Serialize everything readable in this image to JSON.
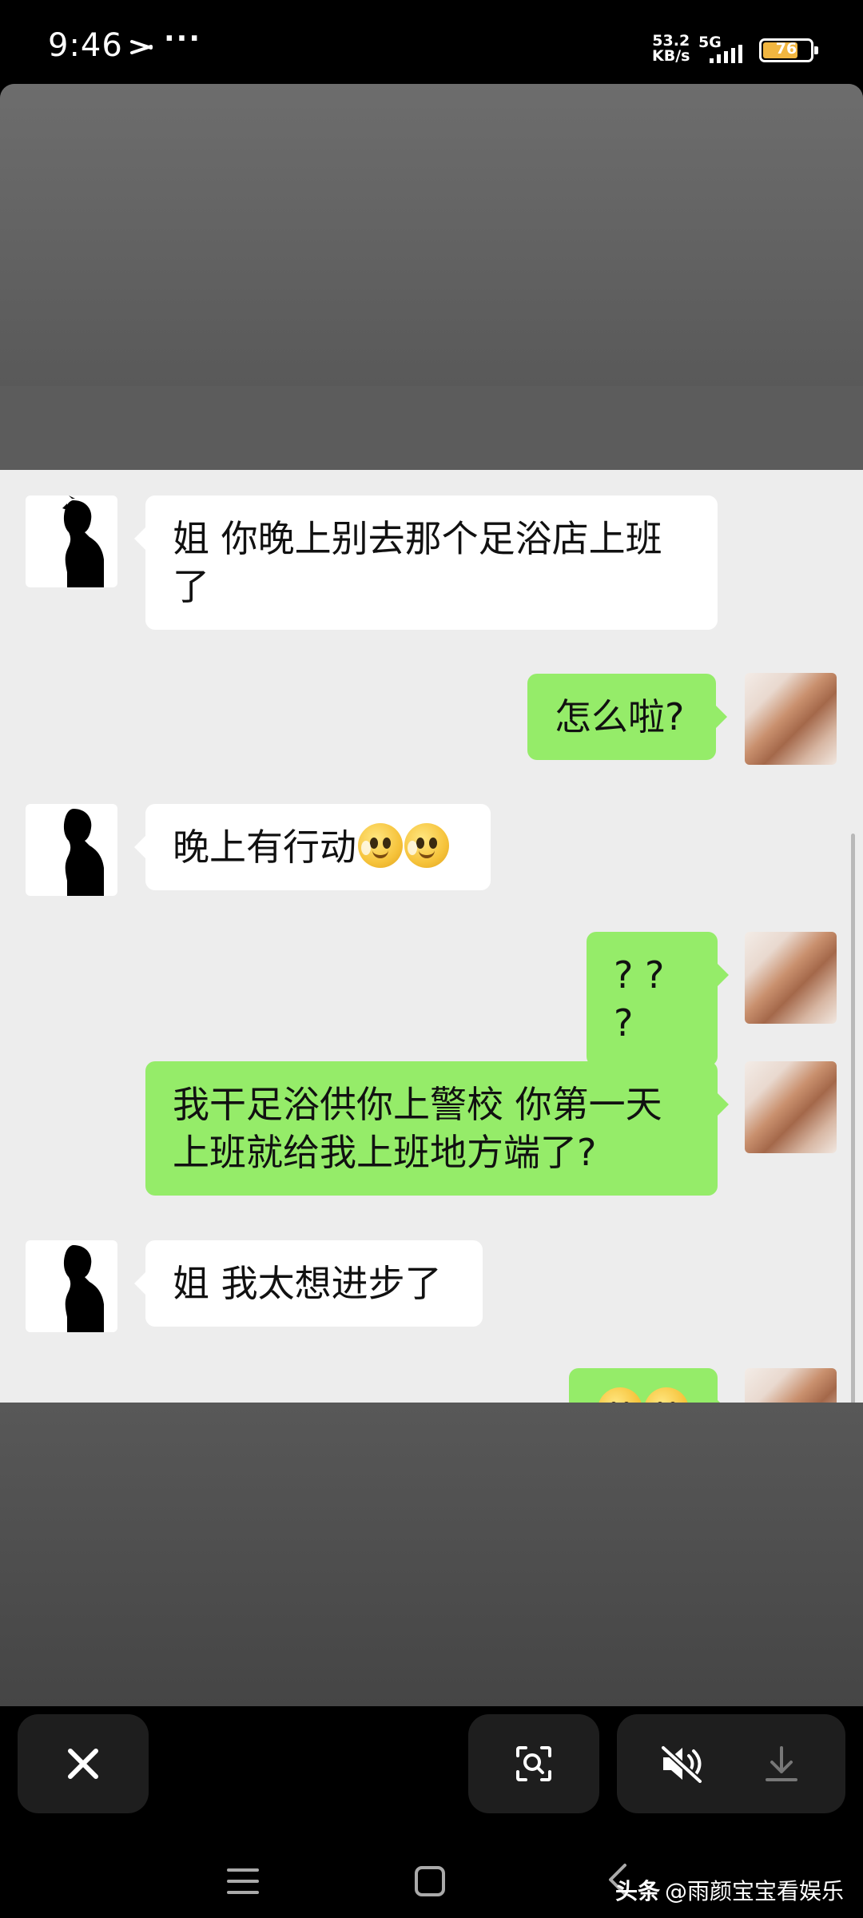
{
  "status_bar": {
    "time": "9:46",
    "dots": "···",
    "net_speed_value": "53.2",
    "net_speed_unit": "KB/s",
    "network": "5G",
    "battery": "76",
    "battery_level_percent": 76,
    "battery_color": "#f1b640"
  },
  "chat": {
    "messages": [
      {
        "side": "left",
        "text_line1": "姐 你晚上别去那个足浴店上班",
        "text_line2": "了"
      },
      {
        "side": "right",
        "text": "怎么啦?"
      },
      {
        "side": "left",
        "text": "晚上有行动",
        "emojis": [
          "sweat-smile-emoji",
          "sweat-smile-emoji"
        ]
      },
      {
        "side": "right",
        "text": "? ? ?"
      },
      {
        "side": "right",
        "text_line1": "我干足浴供你上警校 你第一天",
        "text_line2": "上班就给我上班地方端了?"
      },
      {
        "side": "left",
        "text": "姐 我太想进步了"
      },
      {
        "side": "right",
        "emojis": [
          "smile-emoji",
          "smile-emoji"
        ]
      }
    ],
    "bubble_colors": {
      "incoming": "#ffffff",
      "outgoing": "#95ec69",
      "background": "#ededed"
    }
  },
  "toolbar": {
    "close_icon": "close-icon",
    "lens_icon": "image-search-icon",
    "mute_icon": "mute-icon",
    "download_icon": "download-icon"
  },
  "navbar": {
    "menu_icon": "menu-icon",
    "home_icon": "home-icon",
    "back_icon": "back-icon"
  },
  "watermark": {
    "brand": "头条",
    "author": "@雨颜宝宝看娱乐"
  }
}
